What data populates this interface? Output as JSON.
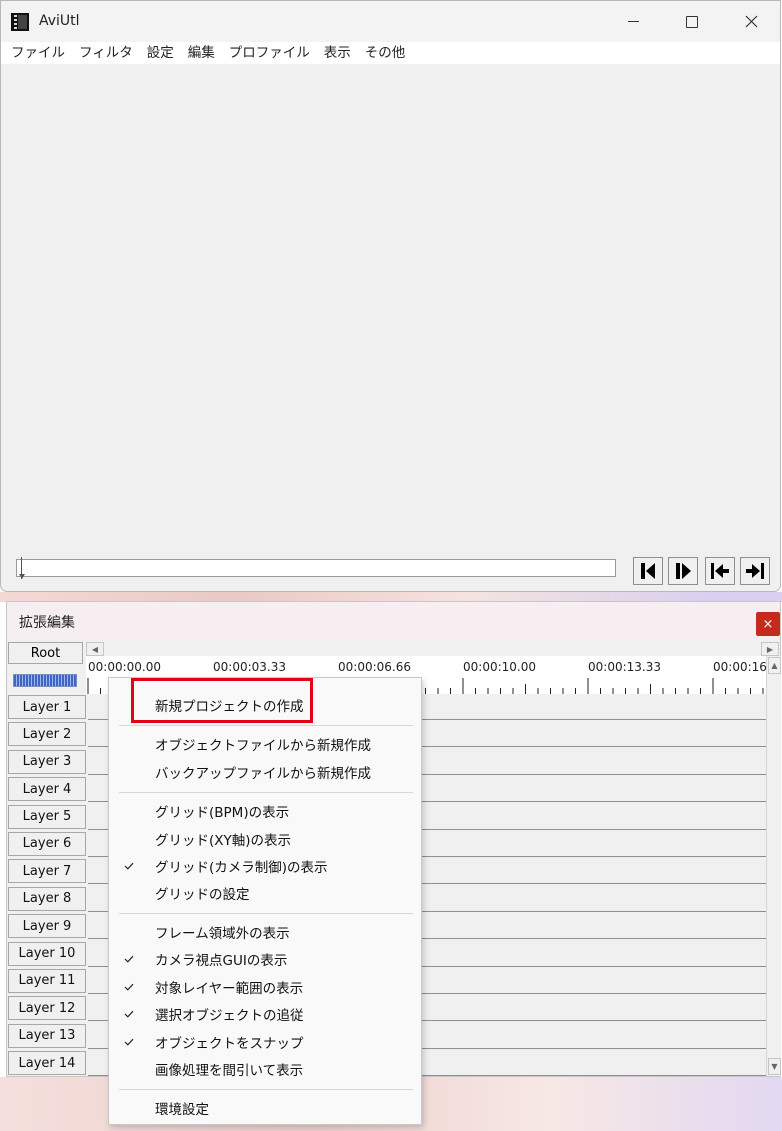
{
  "main_window": {
    "title": "AviUtl",
    "menu": [
      "ファイル",
      "フィルタ",
      "設定",
      "編集",
      "プロファイル",
      "表示",
      "その他"
    ]
  },
  "ext_window": {
    "title": "拡張編集",
    "close_glyph": "×",
    "root_label": "Root",
    "timeline_labels": [
      "00:00:00.00",
      "00:00:03.33",
      "00:00:06.66",
      "00:00:10.00",
      "00:00:13.33",
      "00:00:16"
    ],
    "layers": [
      "Layer 1",
      "Layer 2",
      "Layer 3",
      "Layer 4",
      "Layer 5",
      "Layer 6",
      "Layer 7",
      "Layer 8",
      "Layer 9",
      "Layer 10",
      "Layer 11",
      "Layer 12",
      "Layer 13",
      "Layer 14"
    ]
  },
  "context_menu": {
    "items": [
      {
        "label": "新規プロジェクトの作成",
        "checked": false,
        "highlighted": true
      },
      {
        "label": "オブジェクトファイルから新規作成",
        "checked": false
      },
      {
        "label": "バックアップファイルから新規作成",
        "checked": false
      },
      {
        "label": "グリッド(BPM)の表示",
        "checked": false
      },
      {
        "label": "グリッド(XY軸)の表示",
        "checked": false
      },
      {
        "label": "グリッド(カメラ制御)の表示",
        "checked": true
      },
      {
        "label": "グリッドの設定",
        "checked": false
      },
      {
        "label": "フレーム領域外の表示",
        "checked": false
      },
      {
        "label": "カメラ視点GUIの表示",
        "checked": true
      },
      {
        "label": "対象レイヤー範囲の表示",
        "checked": true
      },
      {
        "label": "選択オブジェクトの追従",
        "checked": true
      },
      {
        "label": "オブジェクトをスナップ",
        "checked": true
      },
      {
        "label": "画像処理を間引いて表示",
        "checked": false
      },
      {
        "label": "環境設定",
        "checked": false
      }
    ]
  },
  "colors": {
    "highlight_box": "#e2001a",
    "close_red": "#c42b1c",
    "zoom_blue": "#3f66c7"
  },
  "icons": [
    "app-icon",
    "minimize-icon",
    "maximize-icon",
    "close-icon",
    "prev-frame-icon",
    "next-frame-icon",
    "first-frame-icon",
    "last-frame-icon",
    "check-icon"
  ]
}
